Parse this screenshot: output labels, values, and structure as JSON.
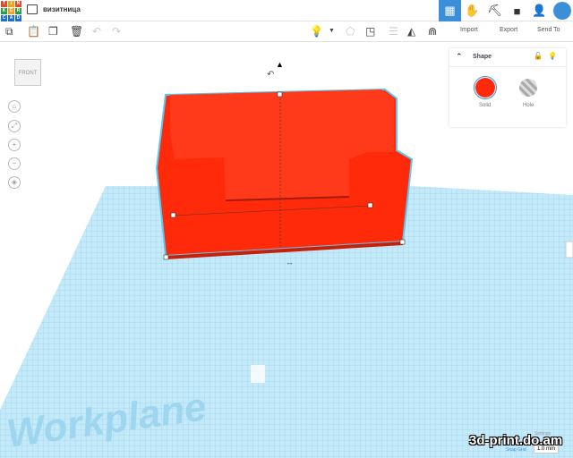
{
  "header": {
    "logo_letters": [
      "T",
      "I",
      "N",
      "K",
      "E",
      "R",
      "C",
      "A",
      "D"
    ],
    "logo_colors": [
      "#e8462a",
      "#f7a21b",
      "#e8462a",
      "#2a9f4a",
      "#f7a21b",
      "#2a9f4a",
      "#1d6fd0",
      "#1d6fd0",
      "#1d6fd0"
    ],
    "title": "визитница"
  },
  "toolbar": {
    "import": "Import",
    "export": "Export",
    "send_to": "Send To"
  },
  "viewcube": {
    "label": "FRONT"
  },
  "shape_panel": {
    "title": "Shape",
    "solid": "Solid",
    "hole": "Hole",
    "solid_color": "#ff2a0a"
  },
  "workplane": {
    "label": "Workplane"
  },
  "bottom": {
    "settings": "Settings",
    "snap_label": "Snap Grid",
    "snap_value": "1.0 mm"
  },
  "watermark": "3d-print.do.am"
}
